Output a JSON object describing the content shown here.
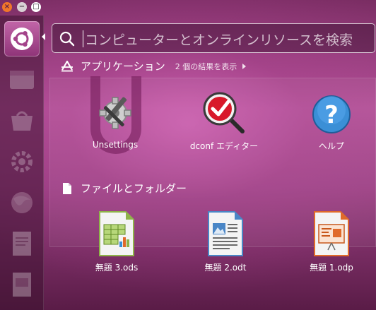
{
  "search": {
    "placeholder": "コンピューターとオンラインリソースを検索"
  },
  "window_controls": {
    "close": "×",
    "minimize": "−",
    "maximize": "□"
  },
  "launcher": {
    "items": [
      {
        "icon": "dash-home-icon",
        "active": true
      },
      {
        "icon": "files-icon",
        "active": false
      },
      {
        "icon": "software-center-icon",
        "active": false
      },
      {
        "icon": "system-settings-icon",
        "active": false
      },
      {
        "icon": "browser-icon",
        "active": false
      },
      {
        "icon": "document-icon",
        "active": false
      },
      {
        "icon": "presentation-icon",
        "active": false
      }
    ]
  },
  "applications": {
    "title": "アプリケーション",
    "count_text": "2 個の結果を表示",
    "items": [
      {
        "label": "Unsettings",
        "icon": "unsettings-icon"
      },
      {
        "label": "dconf エディター",
        "icon": "dconf-editor-icon"
      },
      {
        "label": "ヘルプ",
        "icon": "help-icon"
      }
    ]
  },
  "files": {
    "title": "ファイルとフォルダー",
    "items": [
      {
        "label": "無題 3.ods",
        "icon": "spreadsheet-icon"
      },
      {
        "label": "無題 2.odt",
        "icon": "text-document-icon"
      },
      {
        "label": "無題 1.odp",
        "icon": "presentation-document-icon"
      }
    ]
  },
  "colors": {
    "accent": "#b14f96",
    "ubuntu_orange": "#f0762a"
  }
}
